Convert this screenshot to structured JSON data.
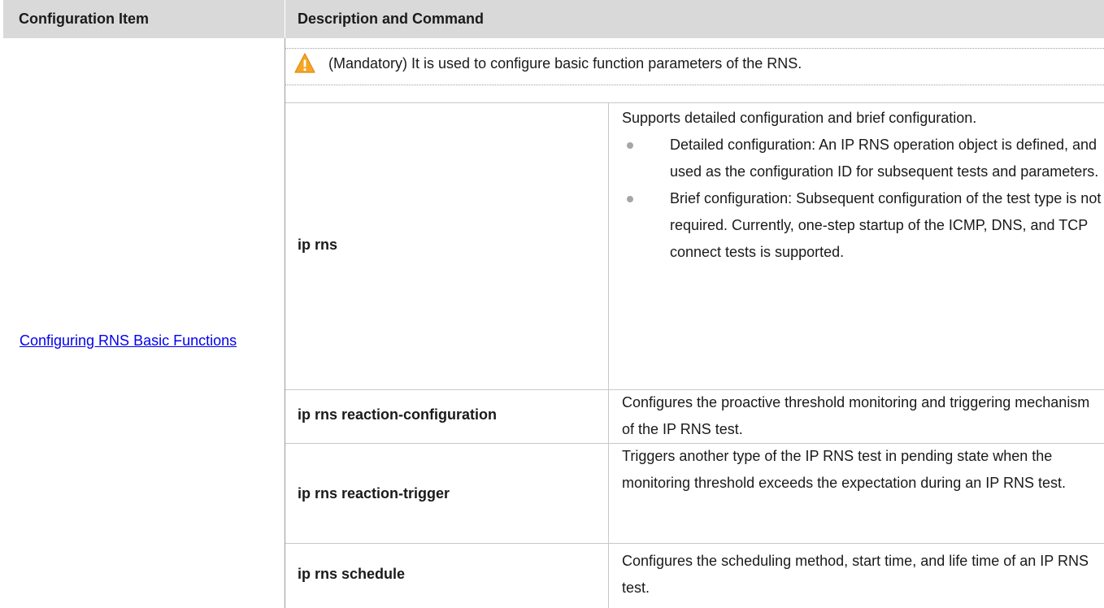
{
  "table": {
    "headers": [
      "Configuration Item",
      "Description and Command"
    ],
    "item_link": "Configuring RNS Basic Functions",
    "note": "(Mandatory) It is used to configure basic function parameters of the RNS.",
    "note_icon": "warning-icon",
    "accent_color": "#f5a623",
    "rows": [
      {
        "command": "ip rns",
        "description": "Supports detailed configuration and brief configuration.",
        "bullets": [
          "Detailed configuration: An IP RNS operation object is defined, and used as the configuration ID for subsequent tests and parameters.",
          "Brief configuration: Subsequent configuration of the test type is not required. Currently, one-step startup of the ICMP, DNS, and TCP connect tests is supported."
        ]
      },
      {
        "command": "ip rns reaction-configuration",
        "description": "Configures the proactive threshold monitoring and triggering mechanism of the IP RNS test."
      },
      {
        "command": "ip rns reaction-trigger",
        "description": "Triggers another type of the IP RNS test in pending state when the monitoring threshold exceeds the expectation during an IP RNS test."
      },
      {
        "command": "ip rns schedule",
        "description": "Configures the scheduling method, start time, and life time of an IP RNS test."
      }
    ]
  }
}
